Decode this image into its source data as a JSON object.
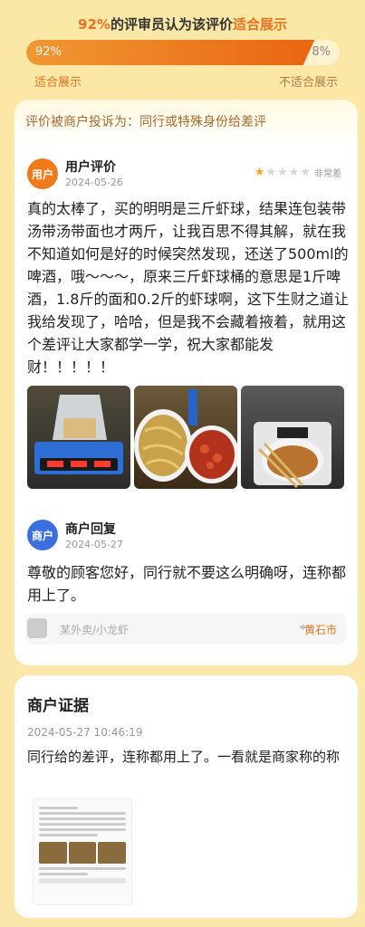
{
  "vote": {
    "title_pct": "92%",
    "title_mid": "的评审员认为该评价",
    "title_hl": "适合展示",
    "left_pct": "92%",
    "right_pct": "8%",
    "fill_fraction": 0.92,
    "label_left": "适合展示",
    "label_right": "不适合展示"
  },
  "complaint": "评价被商户投诉为：同行或特殊身份给差评",
  "review": {
    "avatar": "用户",
    "name": "用户评价",
    "date": "2024-05-26",
    "rating": 1,
    "rating_max": 5,
    "rating_label": "非常差",
    "text": "真的太棒了，买的明明是三斤虾球，结果连包装带汤带汤带面也才两斤，让我百思不得其解，就在我不知道如何是好的时候突然发现，还送了500ml的啤酒，哦～～～，原来三斤虾球桶的意思是1斤啤酒，1.8斤的面和0.2斤的虾球啊，这下生财之道让我给发现了，哈哈，但是我不会藏着掖着，就用这个差评让大家都学一学，祝大家都能发财！！！！！"
  },
  "reply": {
    "avatar": "商户",
    "name": "商户回复",
    "date": "2024-05-27",
    "text": "尊敬的顾客您好，同行就不要这么明确呀，连称都用上了。"
  },
  "shop": {
    "name": "某外卖/小龙虾",
    "city": "黄石市"
  },
  "evidence": {
    "title": "商户证据",
    "time": "2024-05-27 10:46:19",
    "text": "同行给的差评，连称都用上了。一看就是商家称的称"
  },
  "colors": {
    "accent": "#e5731d",
    "merchant_blue": "#3b6fe0",
    "star_on": "#f5a623"
  }
}
